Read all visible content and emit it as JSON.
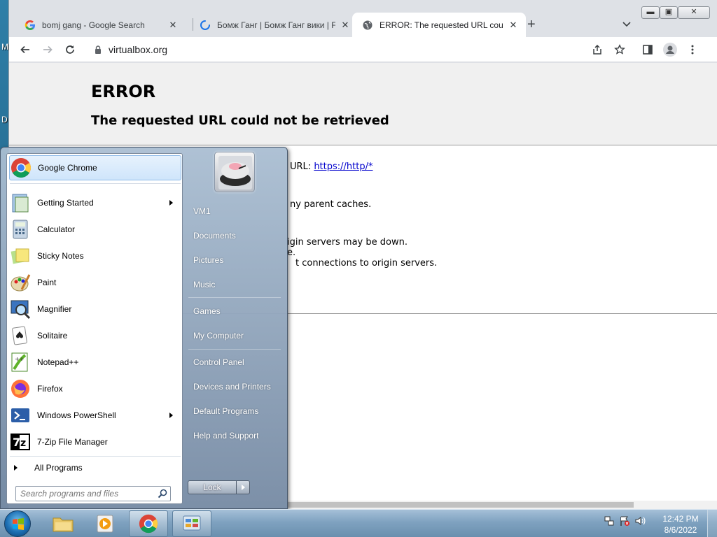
{
  "desktop": {
    "letters": [
      "M",
      "D"
    ]
  },
  "browser": {
    "tabs": [
      {
        "title": "bomj gang - Google Search",
        "close": "✕"
      },
      {
        "title": "Бомж Ганг | Бомж Ганг вики | Fa",
        "close": "✕"
      },
      {
        "title": "ERROR: The requested URL could",
        "close": "✕"
      }
    ],
    "new_tab": "+",
    "window_buttons": {
      "minimize": "▬",
      "maximize": "▣",
      "close": "✕"
    },
    "url": "virtualbox.org"
  },
  "page": {
    "heading": "ERROR",
    "subheading": "The requested URL could not be retrieved",
    "line1_prefix": "URL:",
    "line1_link": "https://http/*",
    "line2": "ny parent caches.",
    "line3": "igin servers may be down.",
    "line4": "e.",
    "line5": "t connections to origin servers."
  },
  "start_menu": {
    "programs": [
      {
        "label": "Google Chrome",
        "icon": "chrome-icon",
        "arrow": false
      },
      {
        "label": "Getting Started",
        "icon": "getting-started-icon",
        "arrow": true
      },
      {
        "label": "Calculator",
        "icon": "calculator-icon",
        "arrow": false
      },
      {
        "label": "Sticky Notes",
        "icon": "sticky-notes-icon",
        "arrow": false
      },
      {
        "label": "Paint",
        "icon": "paint-icon",
        "arrow": false
      },
      {
        "label": "Magnifier",
        "icon": "magnifier-icon",
        "arrow": false
      },
      {
        "label": "Solitaire",
        "icon": "solitaire-icon",
        "arrow": false
      },
      {
        "label": "Notepad++",
        "icon": "notepadpp-icon",
        "arrow": false
      },
      {
        "label": "Firefox",
        "icon": "firefox-icon",
        "arrow": false
      },
      {
        "label": "Windows PowerShell",
        "icon": "powershell-icon",
        "arrow": true
      },
      {
        "label": "7-Zip File Manager",
        "icon": "7zip-icon",
        "arrow": false
      }
    ],
    "all_programs": "All Programs",
    "search_placeholder": "Search programs and files",
    "places": [
      "VM1",
      "Documents",
      "Pictures",
      "Music",
      "Games",
      "My Computer",
      "Control Panel",
      "Devices and Printers",
      "Default Programs",
      "Help and Support"
    ],
    "lock_label": "Lock"
  },
  "taskbar": {
    "time": "12:42 PM",
    "date": "8/6/2022"
  }
}
